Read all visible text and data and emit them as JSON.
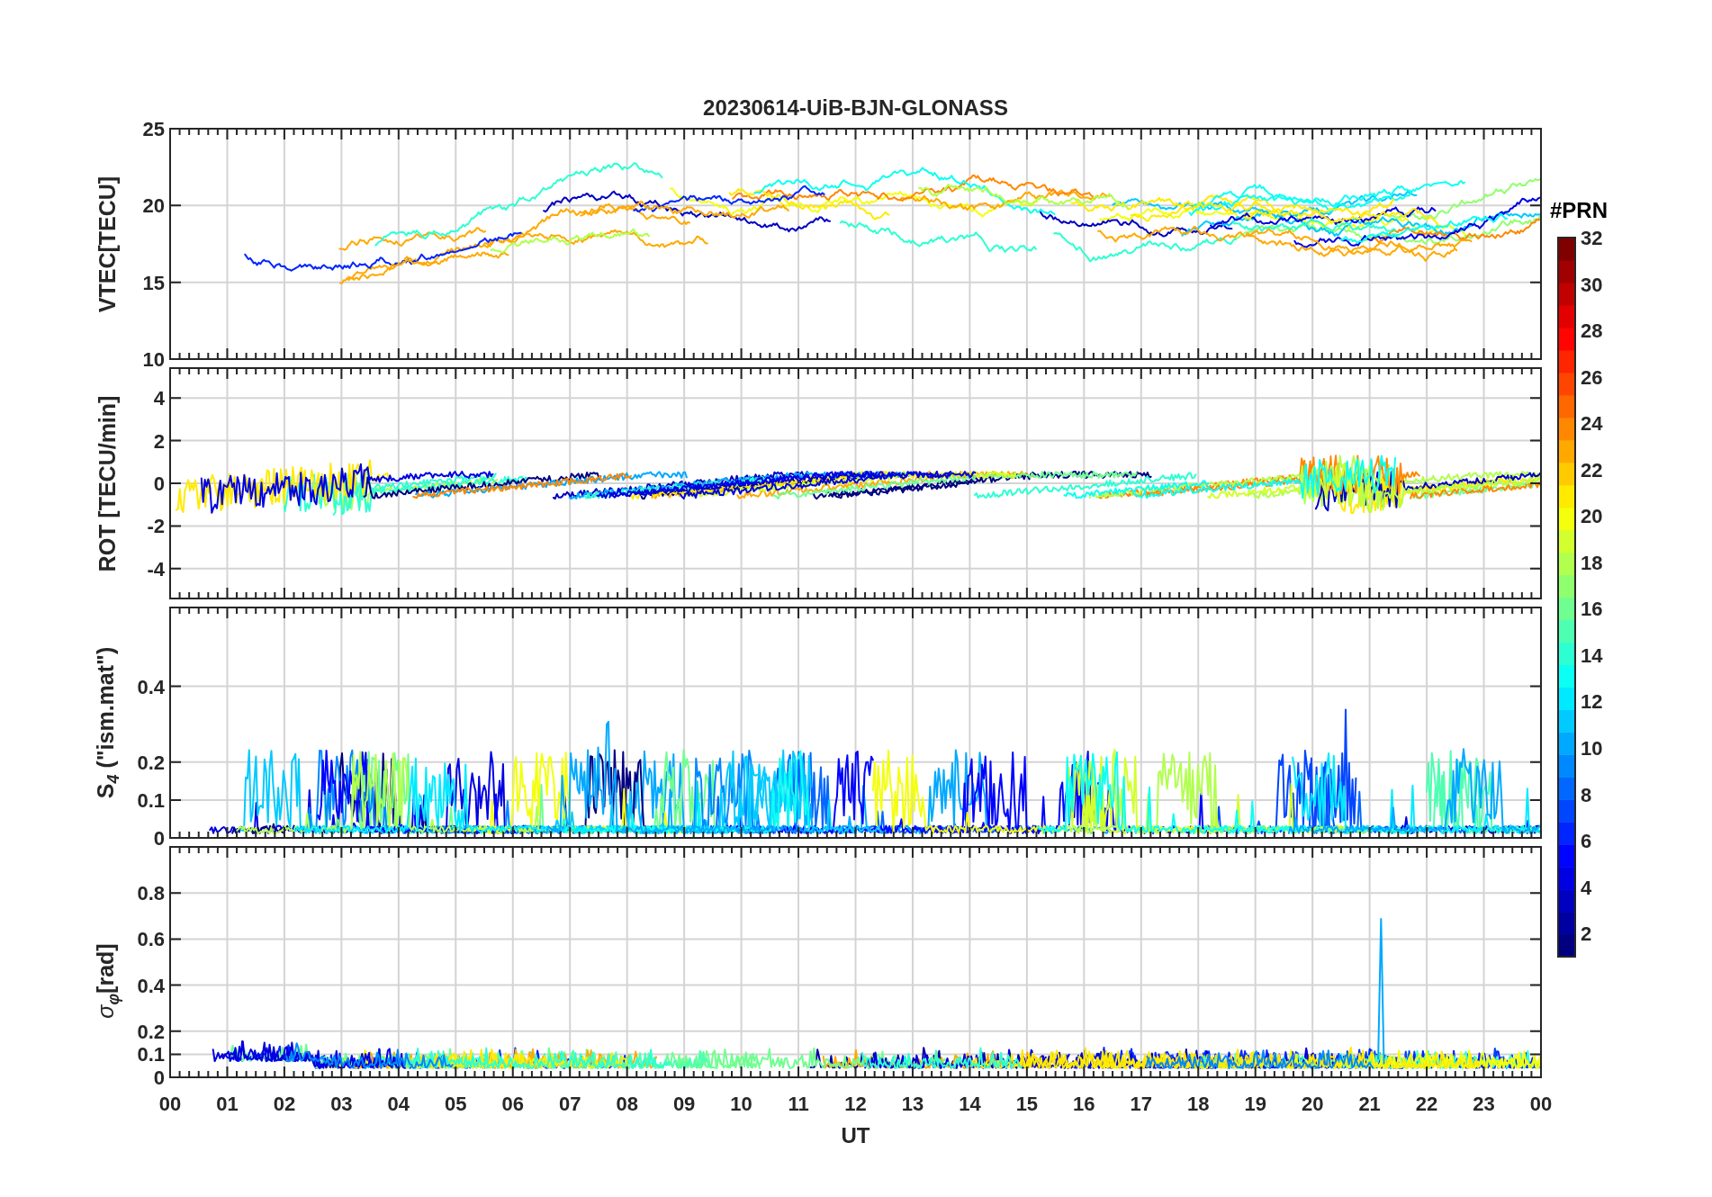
{
  "title": "20230614-UiB-BJN-GLONASS",
  "panels": [
    {
      "ylabel": "VTEC[TECU]",
      "yticks": [
        "25",
        "20",
        "15",
        "10"
      ]
    },
    {
      "ylabel": "ROT [TECU/min]",
      "yticks": [
        "4",
        "2",
        "0",
        "-2",
        "-4"
      ]
    },
    {
      "ylabel": "S$_{4}$ (\"ism.mat\")",
      "yticks": [
        "0.4",
        "0.2",
        "0.1",
        "0"
      ]
    },
    {
      "ylabel": "*σ*$_{φ}$[rad]",
      "yticks": [
        "0.8",
        "0.6",
        "0.4",
        "0.2",
        "0.1",
        "0"
      ]
    }
  ],
  "xticks": [
    "00",
    "01",
    "02",
    "03",
    "04",
    "05",
    "06",
    "07",
    "08",
    "09",
    "10",
    "11",
    "12",
    "13",
    "14",
    "15",
    "16",
    "17",
    "18",
    "19",
    "20",
    "21",
    "22",
    "23",
    "00"
  ],
  "xlabel": "UT",
  "colorbar": {
    "label": "#PRN",
    "ticks": [
      "32",
      "30",
      "28",
      "26",
      "24",
      "22",
      "20",
      "18",
      "16",
      "14",
      "12",
      "10",
      "8",
      "6",
      "4",
      "2"
    ]
  }
}
